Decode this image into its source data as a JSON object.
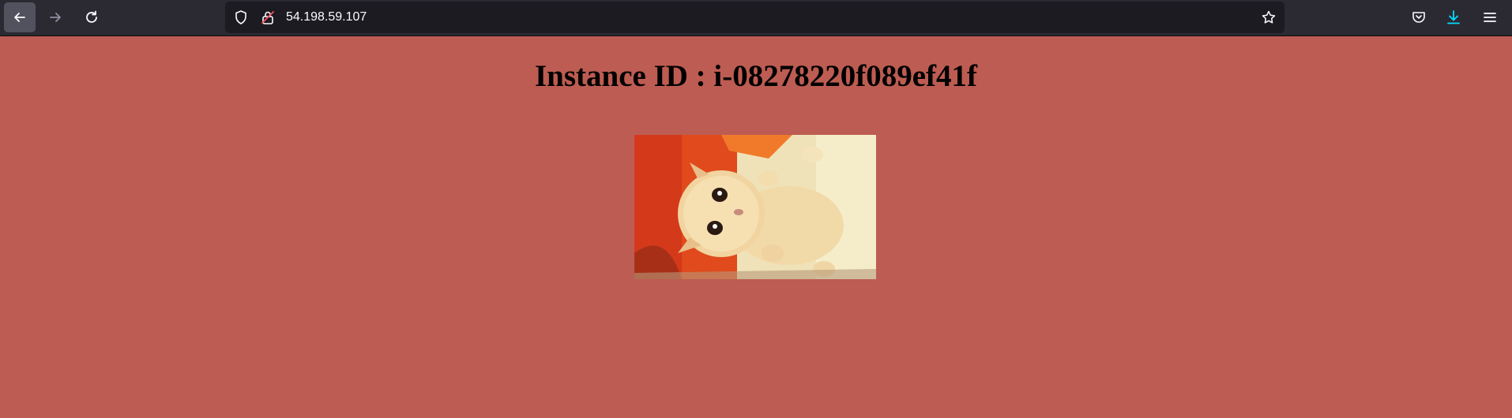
{
  "browser": {
    "url": "54.198.59.107",
    "icons": {
      "back": "arrow-left-icon",
      "forward": "arrow-right-icon",
      "reload": "reload-icon",
      "tracking": "shield-icon",
      "site_security": "lock-insecure-icon",
      "bookmark": "star-icon",
      "pocket": "pocket-icon",
      "downloads": "download-icon",
      "menu": "hamburger-menu-icon"
    },
    "colors": {
      "toolbar": "#2b2a33",
      "urlbar": "#1c1b22",
      "download_accent": "#00ddff"
    }
  },
  "page": {
    "heading": "Instance ID : i-08278220f089ef41f",
    "background": "#bd5c52",
    "image": {
      "alt": "kitten lying on its back on an orange towel"
    }
  }
}
